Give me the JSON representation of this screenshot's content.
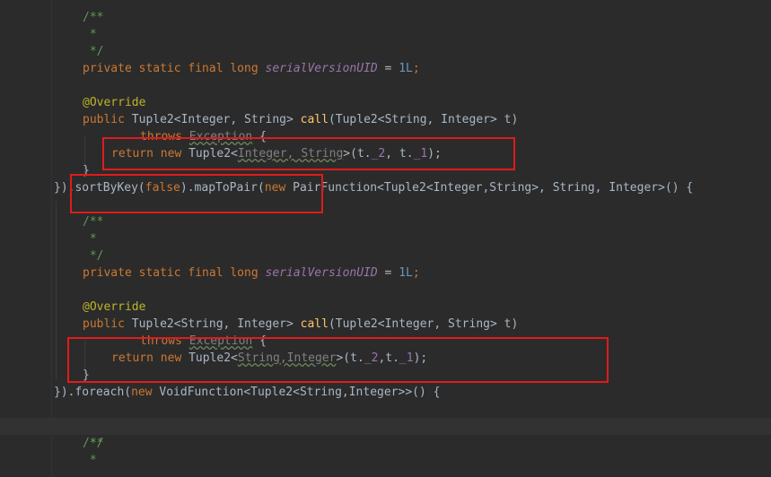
{
  "editor": {
    "lines": [
      {
        "indent": 92,
        "tokens": [
          {
            "t": "/**",
            "c": "cm"
          }
        ]
      },
      {
        "indent": 92,
        "tokens": [
          {
            "t": " *",
            "c": "cm"
          }
        ]
      },
      {
        "indent": 92,
        "tokens": [
          {
            "t": " */",
            "c": "cm"
          }
        ]
      },
      {
        "indent": 92,
        "tokens": [
          {
            "t": "private static final long ",
            "c": "kw"
          },
          {
            "t": "serialVersionUID",
            "c": "fld"
          },
          {
            "t": " = ",
            "c": ""
          },
          {
            "t": "1L",
            "c": "num"
          },
          {
            "t": ";",
            "c": "kw"
          }
        ]
      },
      {
        "indent": 92,
        "tokens": []
      },
      {
        "indent": 92,
        "tokens": [
          {
            "t": "@Override",
            "c": "an"
          }
        ]
      },
      {
        "indent": 92,
        "tokens": [
          {
            "t": "public ",
            "c": "kw"
          },
          {
            "t": "Tuple2<Integer, String> ",
            "c": ""
          },
          {
            "t": "call",
            "c": "fnc"
          },
          {
            "t": "(Tuple2<String, Integer> t)",
            "c": ""
          }
        ]
      },
      {
        "indent": 156,
        "tokens": [
          {
            "t": "throws ",
            "c": "kw"
          },
          {
            "t": "Exception",
            "c": "dim warn"
          },
          {
            "t": " {",
            "c": ""
          }
        ]
      },
      {
        "indent": 124,
        "tokens": [
          {
            "t": "return new ",
            "c": "kw"
          },
          {
            "t": "Tuple2<",
            "c": ""
          },
          {
            "t": "Integer, String",
            "c": "dim warn"
          },
          {
            "t": ">(t.",
            "c": ""
          },
          {
            "t": "_2",
            "c": "fld2"
          },
          {
            "t": ", t.",
            "c": ""
          },
          {
            "t": "_1",
            "c": "fld2"
          },
          {
            "t": ");",
            "c": ""
          }
        ]
      },
      {
        "indent": 92,
        "tokens": [
          {
            "t": "}",
            "c": ""
          }
        ]
      },
      {
        "indent": 60,
        "tokens": [
          {
            "t": "}).sortByKey(",
            "c": ""
          },
          {
            "t": "false",
            "c": "kw"
          },
          {
            "t": ").mapToPair(",
            "c": ""
          },
          {
            "t": "new ",
            "c": "kw"
          },
          {
            "t": "PairFunction<Tuple2<Integer,String>, String, Integer>() {",
            "c": ""
          }
        ]
      },
      {
        "indent": 92,
        "tokens": [
          {
            "t": "/**",
            "c": "cm"
          }
        ]
      },
      {
        "indent": 92,
        "tokens": [
          {
            "t": " *",
            "c": "cm"
          }
        ]
      },
      {
        "indent": 92,
        "tokens": [
          {
            "t": " */",
            "c": "cm"
          }
        ]
      },
      {
        "indent": 92,
        "tokens": [
          {
            "t": "private static final long ",
            "c": "kw"
          },
          {
            "t": "serialVersionUID",
            "c": "fld"
          },
          {
            "t": " = ",
            "c": ""
          },
          {
            "t": "1L",
            "c": "num"
          },
          {
            "t": ";",
            "c": "kw"
          }
        ]
      },
      {
        "indent": 92,
        "tokens": []
      },
      {
        "indent": 92,
        "tokens": [
          {
            "t": "@Override",
            "c": "an"
          }
        ]
      },
      {
        "indent": 92,
        "tokens": [
          {
            "t": "public ",
            "c": "kw"
          },
          {
            "t": "Tuple2<String, Integer> ",
            "c": ""
          },
          {
            "t": "call",
            "c": "fnc"
          },
          {
            "t": "(Tuple2<Integer, String> t)",
            "c": ""
          }
        ]
      },
      {
        "indent": 156,
        "tokens": [
          {
            "t": "throws ",
            "c": "kw"
          },
          {
            "t": "Exception",
            "c": "dim warn"
          },
          {
            "t": " {",
            "c": ""
          }
        ]
      },
      {
        "indent": 124,
        "tokens": [
          {
            "t": "return new ",
            "c": "kw"
          },
          {
            "t": "Tuple2<",
            "c": ""
          },
          {
            "t": "String,Integer",
            "c": "dim warn"
          },
          {
            "t": ">(t.",
            "c": ""
          },
          {
            "t": "_2",
            "c": "fld2"
          },
          {
            "t": ",t.",
            "c": ""
          },
          {
            "t": "_1",
            "c": "fld2"
          },
          {
            "t": ");",
            "c": ""
          }
        ]
      },
      {
        "indent": 92,
        "tokens": [
          {
            "t": "}",
            "c": ""
          }
        ]
      },
      {
        "indent": 60,
        "tokens": [
          {
            "t": "}).foreach(",
            "c": ""
          },
          {
            "t": "new ",
            "c": "kw"
          },
          {
            "t": "VoidFunction<Tuple2<String,Integer>>() {",
            "c": ""
          }
        ]
      },
      {
        "indent": 92,
        "tokens": [],
        "current": true
      },
      {
        "indent": 92,
        "tokens": [
          {
            "t": "/**",
            "c": "cm"
          }
        ]
      },
      {
        "indent": 92,
        "tokens": [
          {
            "t": " *",
            "c": "cm"
          }
        ]
      },
      {
        "indent": 92,
        "tokens": [
          {
            "t": " */",
            "c": "cm"
          }
        ]
      }
    ]
  },
  "colors": {
    "background": "#2b2b2b",
    "keyword": "#cc7832",
    "comment": "#629755",
    "annotation": "#bbb529",
    "number": "#6897bb",
    "method": "#ffc66d",
    "field": "#9876aa",
    "highlight_box": "#e01b1b"
  }
}
